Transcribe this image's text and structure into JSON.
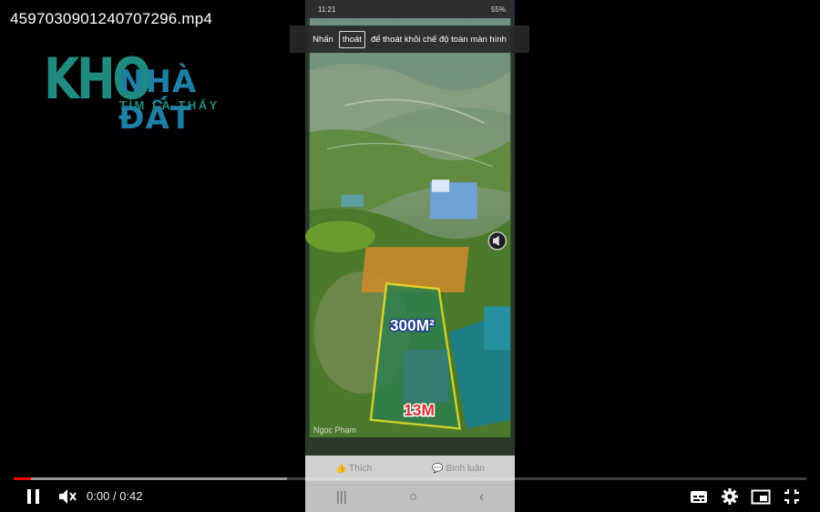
{
  "window": {
    "title": "4597030901240707296.mp4"
  },
  "watermark": {
    "brand_main": "KHO",
    "brand_sub": "NHÀ ĐẤT",
    "tagline": "TÌM LÀ THẤY"
  },
  "phone": {
    "status_time": "11:21",
    "status_battery": "55%",
    "plot_area_label": "300M²",
    "plot_width_label": "13M",
    "author": "Ngọc Phạm",
    "like_label": "Thích",
    "comment_label": "Bình luận"
  },
  "toast": {
    "prefix": "Nhấn",
    "key": "thoát",
    "suffix": "để thoát khỏi chế độ toàn màn hình"
  },
  "player": {
    "current_time": "0:00",
    "separator": "/",
    "duration": "0:42",
    "played_fraction": 0.022,
    "buffered_fraction": 0.345,
    "accent_color": "#ff0000"
  },
  "icons": [
    "pause-icon",
    "mute-icon",
    "subtitles-icon",
    "settings-icon",
    "miniplayer-icon",
    "exit-fullscreen-icon",
    "like-icon",
    "comment-icon",
    "speaker-icon"
  ]
}
